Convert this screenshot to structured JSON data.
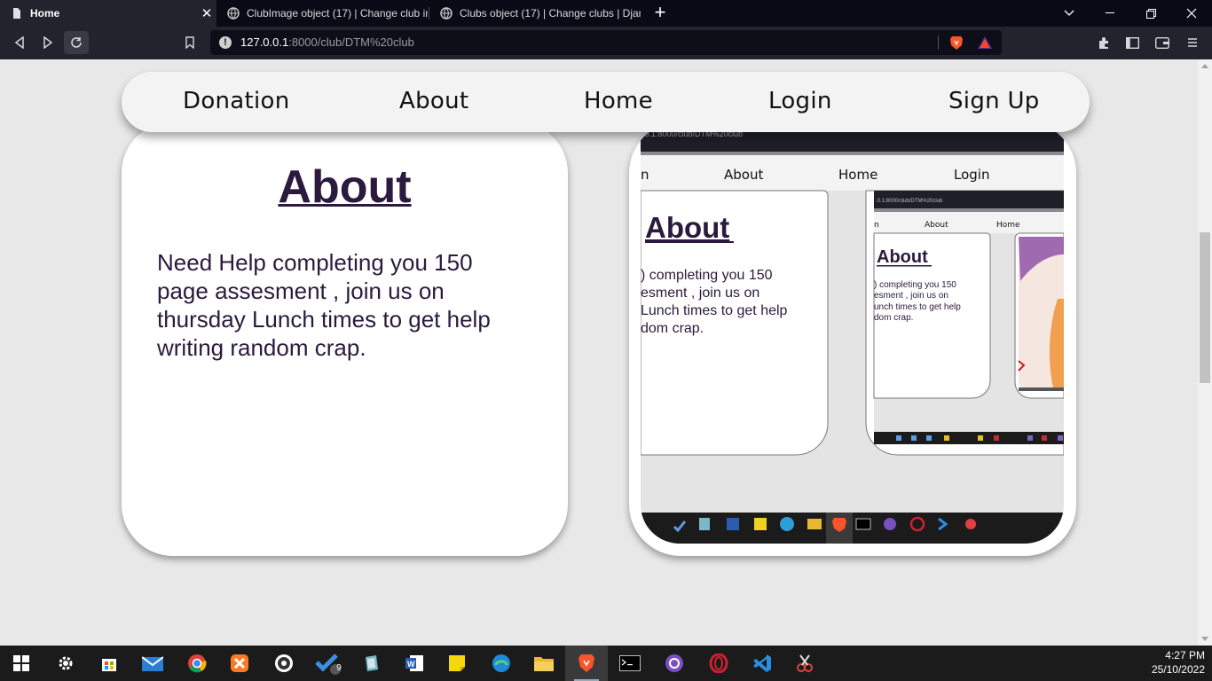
{
  "browser": {
    "tabs": [
      {
        "title": "Home",
        "active": true,
        "icon": "page-icon"
      },
      {
        "title": "ClubImage object (17) | Change club im",
        "active": false,
        "icon": "globe-icon"
      },
      {
        "title": "Clubs object (17) | Change clubs | Djan",
        "active": false,
        "icon": "globe-icon"
      }
    ],
    "close_tab": "✕",
    "new_tab": "+",
    "url_host": "127.0.0.1",
    "url_rest": ":8000/club/DTM%20club"
  },
  "site": {
    "nav": [
      "Donation",
      "About",
      "Home",
      "Login",
      "Sign Up"
    ],
    "about_title": "About",
    "about_text": "Need Help completing you 150 page assesment , join us on thursday Lunch times to get help writing random crap."
  },
  "nested": {
    "level1": {
      "url": ".0.1:8000/club/DTM%20club",
      "nav": [
        "n",
        "About",
        "Home",
        "Login"
      ],
      "about_title": "About",
      "about_text": [
        ") completing you 150",
        "esment , join us on",
        "Lunch times to get help",
        "dom crap."
      ]
    },
    "level2": {
      "url": ".0.1:8000/club/DTM%20club",
      "nav": [
        "n",
        "About",
        "Home"
      ],
      "about_title": "About",
      "about_text": [
        ") completing you 150",
        "esment , join us on",
        "unch times to get help",
        "dom crap."
      ]
    }
  },
  "taskbar": {
    "time": "4:27 PM",
    "date": "25/10/2022",
    "badge_count": "9"
  },
  "colors": {
    "accent_text": "#2b1a3d",
    "page_bg": "#e8e8e8",
    "chrome_dark": "#23232e"
  }
}
